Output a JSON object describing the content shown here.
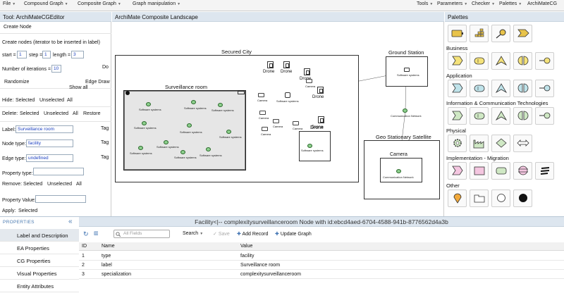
{
  "menubar": {
    "left": [
      "File",
      "Compound Graph",
      "Composite Graph",
      "Graph manipulation"
    ],
    "right": [
      "Tools",
      "Parameters",
      "Checker",
      "Palettes",
      "ArchiMateCG"
    ]
  },
  "tool": {
    "title": "Tool: ArchiMateCGEditor",
    "create_node": "Create Node",
    "create_nodes_label": "Create nodes (iterator to be inserted in label)",
    "start_label": "start =",
    "start_value": "1",
    "step_label": "step =",
    "step_value": "1",
    "length_label": "length =",
    "length_value": "3",
    "iterations_label": "Number of iterations =",
    "iterations_value": "10",
    "do_label": "Do",
    "randomize": "Randomize",
    "show_all": "Show all",
    "edge_draw": "Edge Draw",
    "hide_label": "Hide:",
    "hide_selected": "Selected",
    "hide_unselected": "Unselected",
    "hide_all": "All",
    "delete_label": "Delete:",
    "delete_selected": "Selected",
    "delete_unselected": "Unselected",
    "delete_all": "All",
    "restore": "Restore",
    "label_label": "Label:",
    "label_value": "Surveillance room",
    "node_type_label": "Node type:",
    "node_type_value": "facility",
    "edge_type_label": "Edge type:",
    "edge_type_value": "undefined",
    "tag": "Tag",
    "property_type_label": "Property type:",
    "remove_label": "Remove:",
    "remove_selected": "Selected",
    "remove_unselected": "Unselected",
    "remove_all": "All",
    "property_value_label": "Property Value:",
    "apply_label": "Apply:",
    "apply_selected": "Selected"
  },
  "canvas": {
    "title": "ArchiMate Composite Landscape",
    "secured_city": "Secured City",
    "surveillance_room": "Surveillance room",
    "ground_station": "Ground Station",
    "geo_satellite": "Geo Stationary Satellite",
    "camera": "Camera",
    "drone": "Drone",
    "software_systems": "Software systems",
    "communication_network": "Communication Network",
    "camera_small": "Camera"
  },
  "palette": {
    "title": "Palettes",
    "sections": [
      "Business",
      "Application",
      "Information & Communication Technologies",
      "Physical",
      "Implementation - Migration",
      "Other"
    ]
  },
  "properties": {
    "label": "PROPERTIES",
    "collapse": "«",
    "nav": [
      "Label and Description",
      "EA Properties",
      "CG Properties",
      "Visual Properties",
      "Entity Attributes"
    ],
    "title": "Facility<|-- complexitysurveillanceroom Node with id:ebcd4aed-6704-4588-941b-8776562d4a3b",
    "search_placeholder": "All Fields",
    "search_btn": "Search",
    "save_btn": "Save",
    "add_record_btn": "Add Record",
    "update_graph_btn": "Update Graph",
    "columns": [
      "ID",
      "Name",
      "Value"
    ],
    "rows": [
      [
        "1",
        "type",
        "facility"
      ],
      [
        "2",
        "label",
        "Surveillance room"
      ],
      [
        "3",
        "specialization",
        "complexitysurveillanceroom"
      ]
    ]
  }
}
